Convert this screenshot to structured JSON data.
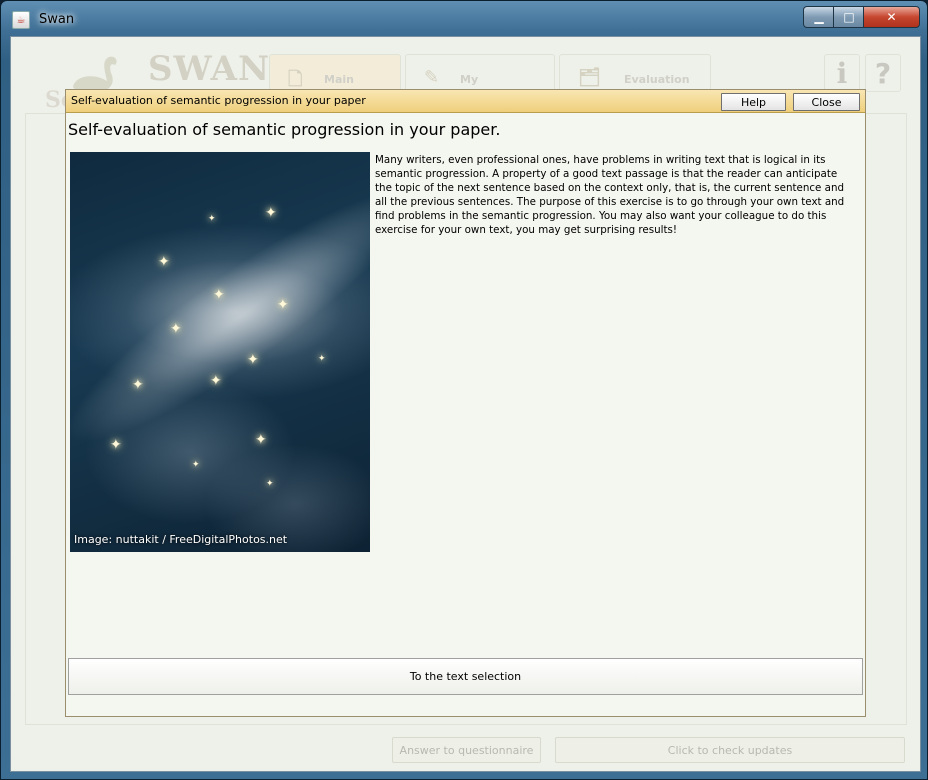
{
  "window": {
    "title": "Swan",
    "controls": {
      "minimize": "▁",
      "maximize": "□",
      "close": "✕"
    }
  },
  "app": {
    "logo": "SWAN",
    "sc_fragment": "Sc",
    "tabs": [
      {
        "label": "Main",
        "icon": "document-icon"
      },
      {
        "label": "My",
        "icon": "pen-icon"
      },
      {
        "label": "Evaluation",
        "icon": "cards-icon"
      }
    ],
    "info_glyph": "i",
    "help_glyph": "?",
    "bottom_buttons": {
      "questionnaire": "Answer to questionnaire",
      "updates": "Click to check updates"
    }
  },
  "dialog": {
    "title": "Self-evaluation of semantic progression in your paper",
    "help_label": "Help",
    "close_label": "Close",
    "heading": "Self-evaluation of semantic progression in your paper.",
    "image_credit": "Image: nuttakit / FreeDigitalPhotos.net",
    "body": "Many writers, even professional ones, have problems in writing text that is logical in its semantic progression. A property of a good text passage is that the reader can anticipate the topic of the next sentence based on the context only, that is, the current sentence and all the previous sentences. The purpose of this exercise is to go through your own text and find problems in the semantic progression. You may also want your colleague to do this exercise for your own text, you may get surprising results!",
    "next_button": "To the text selection"
  }
}
